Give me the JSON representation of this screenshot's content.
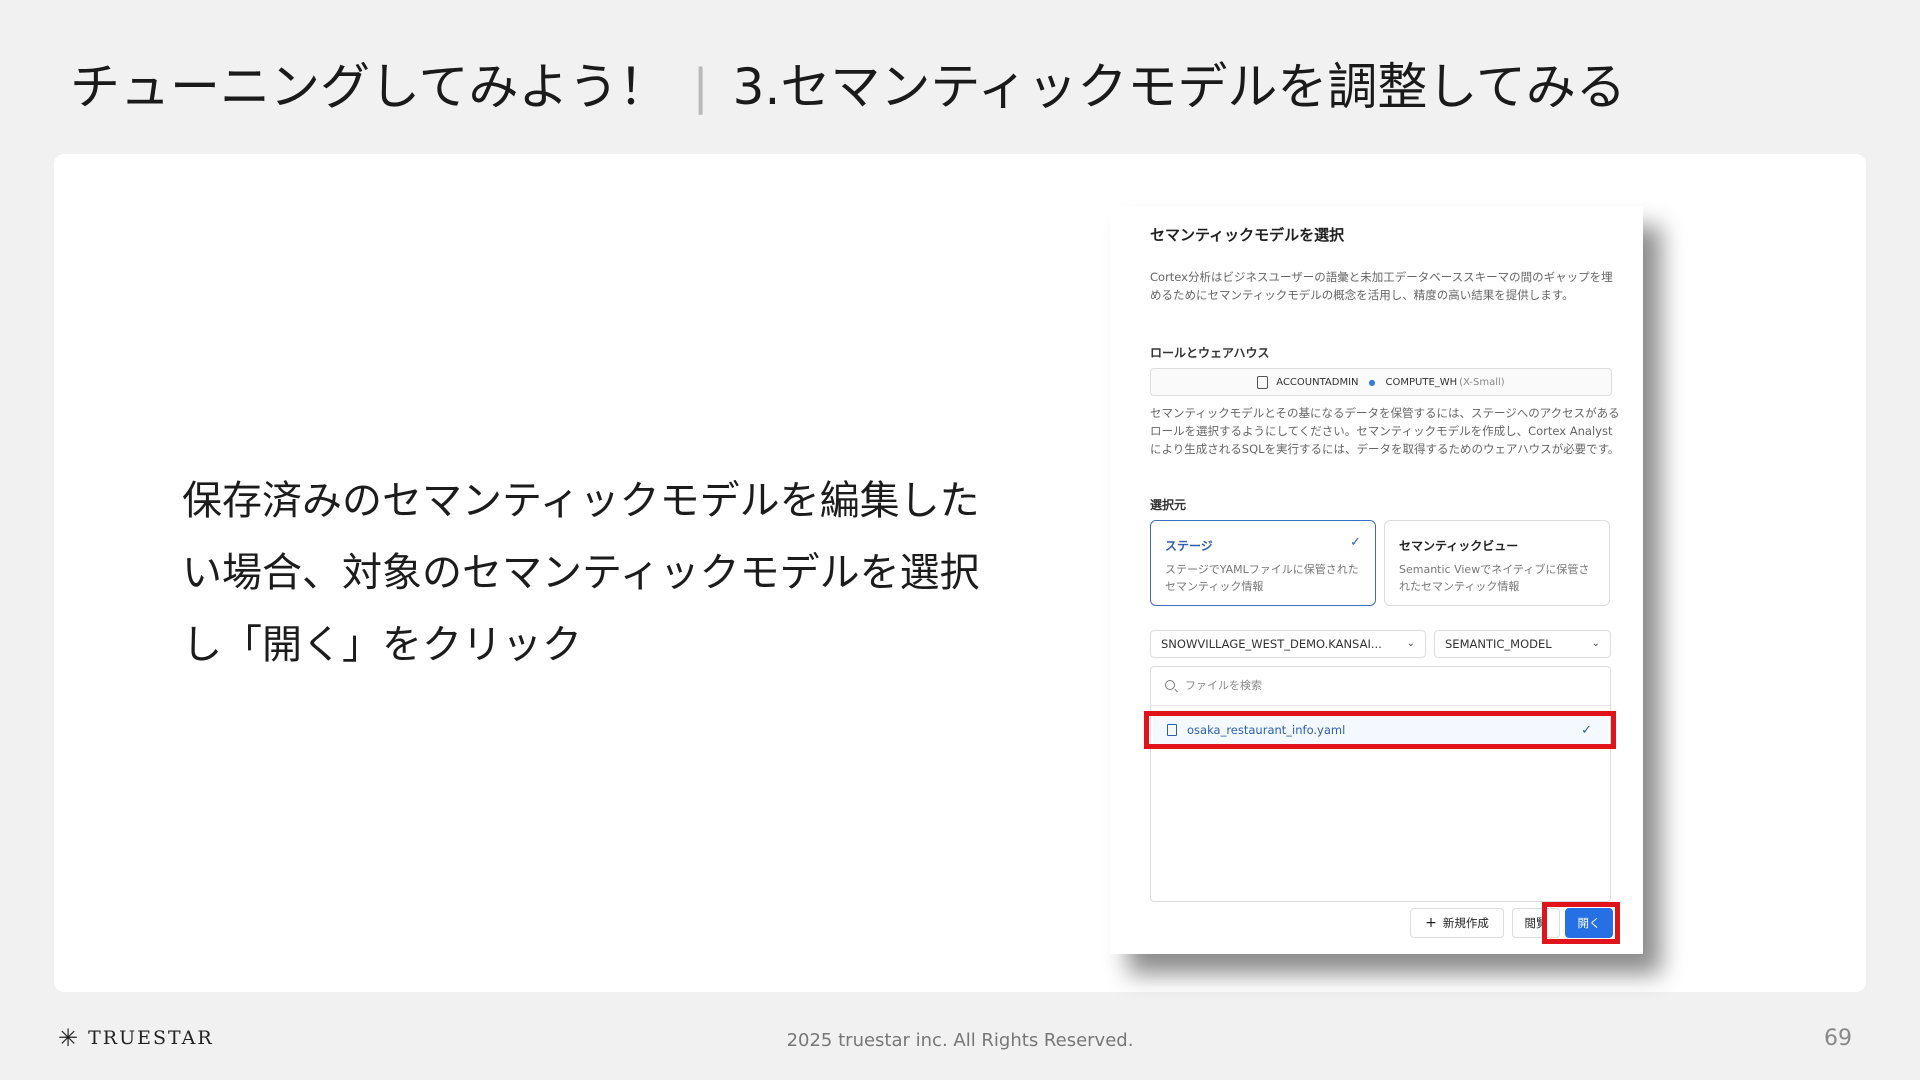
{
  "slide": {
    "title_main": "チューニングしてみよう！",
    "title_sep": "|",
    "title_sub": "3.セマンティックモデルを調整してみる",
    "instruction": "保存済みのセマンティックモデルを編集したい場合、対象のセマンティックモデルを選択し「開く」をクリック"
  },
  "dialog": {
    "title": "セマンティックモデルを選択",
    "description": "Cortex分析はビジネスユーザーの語彙と未加工データベーススキーマの間のギャップを埋めるためにセマンティックモデルの概念を活用し、精度の高い結果を提供します。",
    "role_section_label": "ロールとウェアハウス",
    "role": "ACCOUNTADMIN",
    "warehouse": "COMPUTE_WH",
    "warehouse_size": "(X-Small)",
    "note": "セマンティックモデルとその基になるデータを保管するには、ステージへのアクセスがあるロールを選択するようにしてください。セマンティックモデルを作成し、Cortex Analystにより生成されるSQLを実行するには、データを取得するためのウェアハウスが必要です。",
    "source_section_label": "選択元",
    "sources": [
      {
        "title": "ステージ",
        "desc": "ステージでYAMLファイルに保管されたセマンティック情報",
        "selected": true
      },
      {
        "title": "セマンティックビュー",
        "desc": "Semantic Viewでネイティブに保管されたセマンティック情報",
        "selected": false
      }
    ],
    "schema_select": "SNOWVILLAGE_WEST_DEMO.KANSAI...",
    "stage_select": "SEMANTIC_MODEL",
    "search_placeholder": "ファイルを検索",
    "file_item": "osaka_restaurant_info.yaml",
    "buttons": {
      "new": "新規作成",
      "browse": "閲覧",
      "open": "開く"
    }
  },
  "footer": {
    "logo": "TRUESTAR",
    "copyright": "2025 truestar inc. All Rights Reserved.",
    "page_number": "69"
  },
  "colors": {
    "highlight": "#e0141a",
    "primary_button": "#2670e6",
    "selected_accent": "#2d5fb0"
  }
}
